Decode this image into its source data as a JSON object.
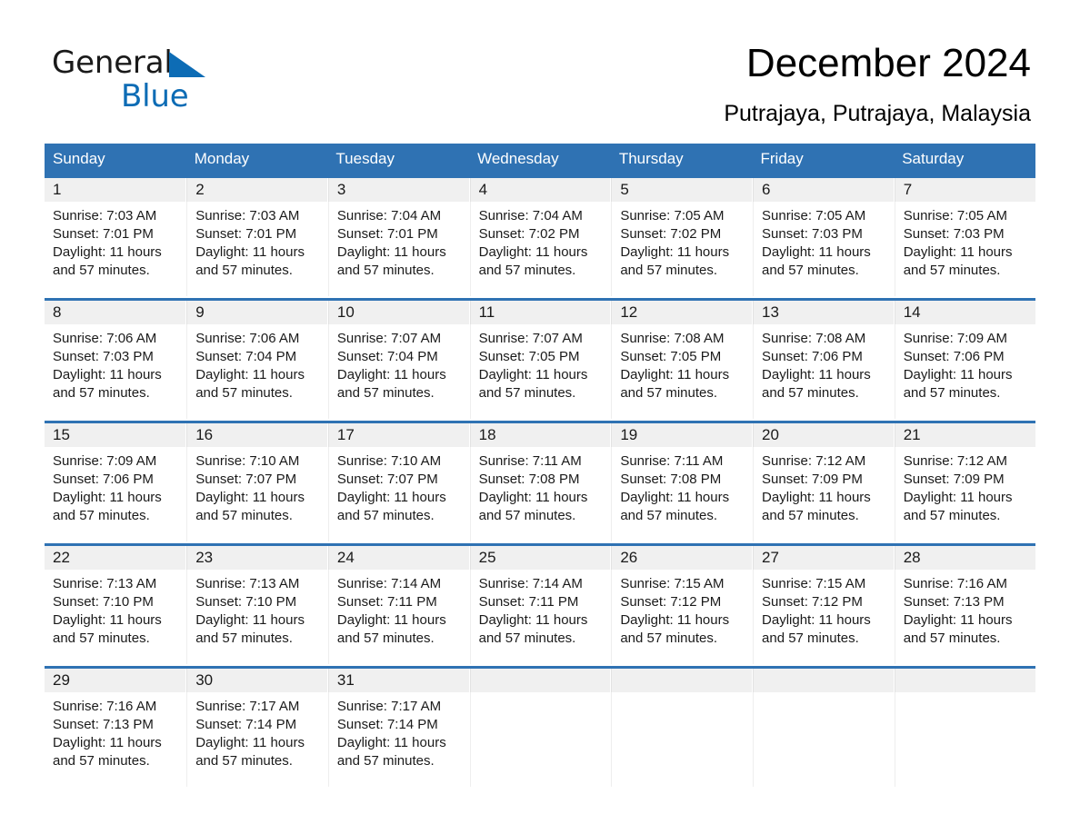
{
  "brand": {
    "name_part1": "General",
    "name_part2": "Blue",
    "accent_color": "#0d6cb5"
  },
  "header": {
    "title": "December 2024",
    "location": "Putrajaya, Putrajaya, Malaysia"
  },
  "theme": {
    "header_blue": "#2f72b3",
    "daynum_band": "#f0f0f0",
    "text": "#1a1a1a"
  },
  "weekday_headers": [
    "Sunday",
    "Monday",
    "Tuesday",
    "Wednesday",
    "Thursday",
    "Friday",
    "Saturday"
  ],
  "weeks": [
    [
      {
        "day": "1",
        "sunrise": "Sunrise: 7:03 AM",
        "sunset": "Sunset: 7:01 PM",
        "daylight_1": "Daylight: 11 hours",
        "daylight_2": "and 57 minutes."
      },
      {
        "day": "2",
        "sunrise": "Sunrise: 7:03 AM",
        "sunset": "Sunset: 7:01 PM",
        "daylight_1": "Daylight: 11 hours",
        "daylight_2": "and 57 minutes."
      },
      {
        "day": "3",
        "sunrise": "Sunrise: 7:04 AM",
        "sunset": "Sunset: 7:01 PM",
        "daylight_1": "Daylight: 11 hours",
        "daylight_2": "and 57 minutes."
      },
      {
        "day": "4",
        "sunrise": "Sunrise: 7:04 AM",
        "sunset": "Sunset: 7:02 PM",
        "daylight_1": "Daylight: 11 hours",
        "daylight_2": "and 57 minutes."
      },
      {
        "day": "5",
        "sunrise": "Sunrise: 7:05 AM",
        "sunset": "Sunset: 7:02 PM",
        "daylight_1": "Daylight: 11 hours",
        "daylight_2": "and 57 minutes."
      },
      {
        "day": "6",
        "sunrise": "Sunrise: 7:05 AM",
        "sunset": "Sunset: 7:03 PM",
        "daylight_1": "Daylight: 11 hours",
        "daylight_2": "and 57 minutes."
      },
      {
        "day": "7",
        "sunrise": "Sunrise: 7:05 AM",
        "sunset": "Sunset: 7:03 PM",
        "daylight_1": "Daylight: 11 hours",
        "daylight_2": "and 57 minutes."
      }
    ],
    [
      {
        "day": "8",
        "sunrise": "Sunrise: 7:06 AM",
        "sunset": "Sunset: 7:03 PM",
        "daylight_1": "Daylight: 11 hours",
        "daylight_2": "and 57 minutes."
      },
      {
        "day": "9",
        "sunrise": "Sunrise: 7:06 AM",
        "sunset": "Sunset: 7:04 PM",
        "daylight_1": "Daylight: 11 hours",
        "daylight_2": "and 57 minutes."
      },
      {
        "day": "10",
        "sunrise": "Sunrise: 7:07 AM",
        "sunset": "Sunset: 7:04 PM",
        "daylight_1": "Daylight: 11 hours",
        "daylight_2": "and 57 minutes."
      },
      {
        "day": "11",
        "sunrise": "Sunrise: 7:07 AM",
        "sunset": "Sunset: 7:05 PM",
        "daylight_1": "Daylight: 11 hours",
        "daylight_2": "and 57 minutes."
      },
      {
        "day": "12",
        "sunrise": "Sunrise: 7:08 AM",
        "sunset": "Sunset: 7:05 PM",
        "daylight_1": "Daylight: 11 hours",
        "daylight_2": "and 57 minutes."
      },
      {
        "day": "13",
        "sunrise": "Sunrise: 7:08 AM",
        "sunset": "Sunset: 7:06 PM",
        "daylight_1": "Daylight: 11 hours",
        "daylight_2": "and 57 minutes."
      },
      {
        "day": "14",
        "sunrise": "Sunrise: 7:09 AM",
        "sunset": "Sunset: 7:06 PM",
        "daylight_1": "Daylight: 11 hours",
        "daylight_2": "and 57 minutes."
      }
    ],
    [
      {
        "day": "15",
        "sunrise": "Sunrise: 7:09 AM",
        "sunset": "Sunset: 7:06 PM",
        "daylight_1": "Daylight: 11 hours",
        "daylight_2": "and 57 minutes."
      },
      {
        "day": "16",
        "sunrise": "Sunrise: 7:10 AM",
        "sunset": "Sunset: 7:07 PM",
        "daylight_1": "Daylight: 11 hours",
        "daylight_2": "and 57 minutes."
      },
      {
        "day": "17",
        "sunrise": "Sunrise: 7:10 AM",
        "sunset": "Sunset: 7:07 PM",
        "daylight_1": "Daylight: 11 hours",
        "daylight_2": "and 57 minutes."
      },
      {
        "day": "18",
        "sunrise": "Sunrise: 7:11 AM",
        "sunset": "Sunset: 7:08 PM",
        "daylight_1": "Daylight: 11 hours",
        "daylight_2": "and 57 minutes."
      },
      {
        "day": "19",
        "sunrise": "Sunrise: 7:11 AM",
        "sunset": "Sunset: 7:08 PM",
        "daylight_1": "Daylight: 11 hours",
        "daylight_2": "and 57 minutes."
      },
      {
        "day": "20",
        "sunrise": "Sunrise: 7:12 AM",
        "sunset": "Sunset: 7:09 PM",
        "daylight_1": "Daylight: 11 hours",
        "daylight_2": "and 57 minutes."
      },
      {
        "day": "21",
        "sunrise": "Sunrise: 7:12 AM",
        "sunset": "Sunset: 7:09 PM",
        "daylight_1": "Daylight: 11 hours",
        "daylight_2": "and 57 minutes."
      }
    ],
    [
      {
        "day": "22",
        "sunrise": "Sunrise: 7:13 AM",
        "sunset": "Sunset: 7:10 PM",
        "daylight_1": "Daylight: 11 hours",
        "daylight_2": "and 57 minutes."
      },
      {
        "day": "23",
        "sunrise": "Sunrise: 7:13 AM",
        "sunset": "Sunset: 7:10 PM",
        "daylight_1": "Daylight: 11 hours",
        "daylight_2": "and 57 minutes."
      },
      {
        "day": "24",
        "sunrise": "Sunrise: 7:14 AM",
        "sunset": "Sunset: 7:11 PM",
        "daylight_1": "Daylight: 11 hours",
        "daylight_2": "and 57 minutes."
      },
      {
        "day": "25",
        "sunrise": "Sunrise: 7:14 AM",
        "sunset": "Sunset: 7:11 PM",
        "daylight_1": "Daylight: 11 hours",
        "daylight_2": "and 57 minutes."
      },
      {
        "day": "26",
        "sunrise": "Sunrise: 7:15 AM",
        "sunset": "Sunset: 7:12 PM",
        "daylight_1": "Daylight: 11 hours",
        "daylight_2": "and 57 minutes."
      },
      {
        "day": "27",
        "sunrise": "Sunrise: 7:15 AM",
        "sunset": "Sunset: 7:12 PM",
        "daylight_1": "Daylight: 11 hours",
        "daylight_2": "and 57 minutes."
      },
      {
        "day": "28",
        "sunrise": "Sunrise: 7:16 AM",
        "sunset": "Sunset: 7:13 PM",
        "daylight_1": "Daylight: 11 hours",
        "daylight_2": "and 57 minutes."
      }
    ],
    [
      {
        "day": "29",
        "sunrise": "Sunrise: 7:16 AM",
        "sunset": "Sunset: 7:13 PM",
        "daylight_1": "Daylight: 11 hours",
        "daylight_2": "and 57 minutes."
      },
      {
        "day": "30",
        "sunrise": "Sunrise: 7:17 AM",
        "sunset": "Sunset: 7:14 PM",
        "daylight_1": "Daylight: 11 hours",
        "daylight_2": "and 57 minutes."
      },
      {
        "day": "31",
        "sunrise": "Sunrise: 7:17 AM",
        "sunset": "Sunset: 7:14 PM",
        "daylight_1": "Daylight: 11 hours",
        "daylight_2": "and 57 minutes."
      },
      {
        "day": "",
        "sunrise": "",
        "sunset": "",
        "daylight_1": "",
        "daylight_2": ""
      },
      {
        "day": "",
        "sunrise": "",
        "sunset": "",
        "daylight_1": "",
        "daylight_2": ""
      },
      {
        "day": "",
        "sunrise": "",
        "sunset": "",
        "daylight_1": "",
        "daylight_2": ""
      },
      {
        "day": "",
        "sunrise": "",
        "sunset": "",
        "daylight_1": "",
        "daylight_2": ""
      }
    ]
  ]
}
